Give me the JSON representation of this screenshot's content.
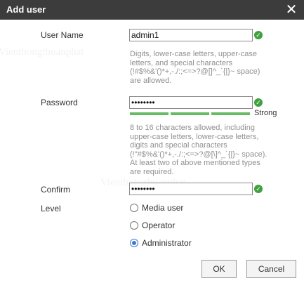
{
  "dialog": {
    "title": "Add user",
    "close_glyph": "✕"
  },
  "form": {
    "username": {
      "label": "User Name",
      "value": "admin1",
      "hint": "Digits, lower-case letters, upper-case letters, and special characters (!#$%&'()*+,-./:;<=>?@[]^_`{|}~ space) are allowed."
    },
    "password": {
      "label": "Password",
      "value": "••••••••",
      "strength": "Strong",
      "strength_level": 3,
      "hint": "8 to 16 characters allowed, including upper-case letters, lower-case letters, digits and special characters (!\"#$%&'()*+,-./:;<=>?@[\\]^_`{|}~ space). At least two of above mentioned types are required."
    },
    "confirm": {
      "label": "Confirm",
      "value": "••••••••"
    },
    "level": {
      "label": "Level",
      "options": [
        "Media user",
        "Operator",
        "Administrator"
      ],
      "selected": "Administrator"
    }
  },
  "buttons": {
    "ok": "OK",
    "cancel": "Cancel"
  },
  "icons": {
    "valid": "check-circle-icon",
    "close": "close-icon"
  },
  "colors": {
    "titlebar": "#3c3c3c",
    "valid_green": "#3fa23f",
    "strength_bar": "#66bb66",
    "radio_selected": "#3a7bd5",
    "hint_text": "#909090"
  },
  "watermark": {
    "text": "Vienthongthuanphat"
  }
}
